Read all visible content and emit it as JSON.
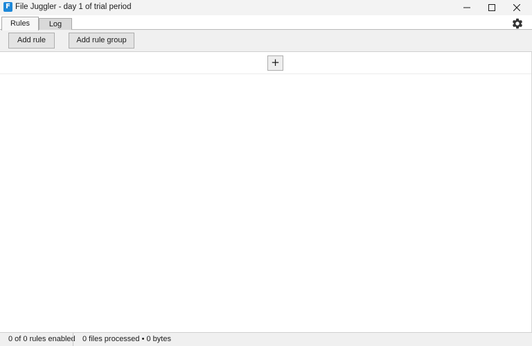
{
  "window": {
    "title": "File Juggler - day 1 of trial period",
    "icon_letter": "F",
    "icon": "file-juggler-app-icon",
    "controls": {
      "minimize_icon": "minimize-icon",
      "maximize_icon": "maximize-icon",
      "close_icon": "close-icon"
    }
  },
  "tabs": [
    {
      "label": "Rules",
      "selected": true
    },
    {
      "label": "Log",
      "selected": false
    }
  ],
  "settings_icon": "gear-icon",
  "toolbar": {
    "add_rule_label": "Add rule",
    "add_rule_group_label": "Add rule group"
  },
  "rules_area": {
    "add_button_label": "+"
  },
  "status": {
    "rules_enabled": "0 of 0 rules enabled",
    "files_processed": "0 files processed • 0 bytes"
  },
  "colors": {
    "app_icon": "#1e88d8",
    "titlebar": "#f3f3f3",
    "toolbar": "#f0f0f0"
  }
}
